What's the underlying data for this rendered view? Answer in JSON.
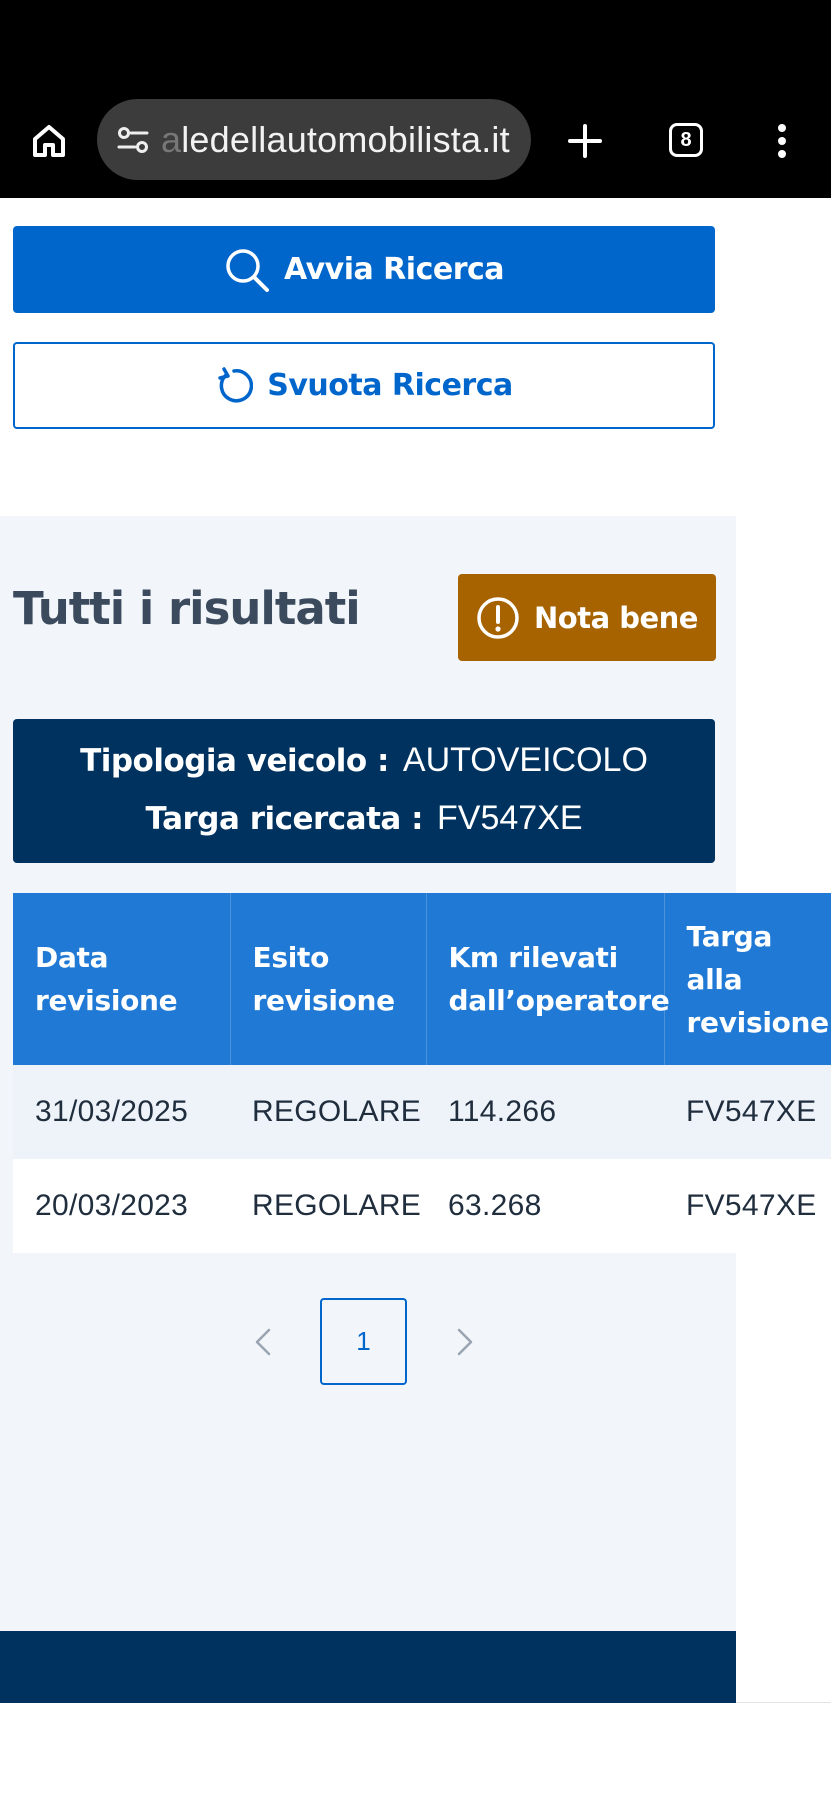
{
  "browser": {
    "url_faded": "a",
    "url": "ledellautomobilista.it",
    "tab_count": "8"
  },
  "buttons": {
    "search_label": "Avvia Ricerca",
    "reset_label": "Svuota Ricerca",
    "note_label": "Nota bene"
  },
  "results": {
    "title": "Tutti i risultati",
    "vehicle_type_label": "Tipologia veicolo :",
    "vehicle_type_value": "AUTOVEICOLO",
    "plate_label": "Targa ricercata :",
    "plate_value": "FV547XE"
  },
  "table": {
    "headers": {
      "c0": "Data revisione",
      "c1": "Esito revisione",
      "c2": "Km rilevati dall’operatore",
      "c3": "Targa alla revisione"
    },
    "rows": [
      {
        "date": "31/03/2025",
        "outcome": "REGOLARE",
        "km": "114.266",
        "plate": "FV547XE"
      },
      {
        "date": "20/03/2023",
        "outcome": "REGOLARE",
        "km": "63.268",
        "plate": "FV547XE"
      }
    ]
  },
  "pagination": {
    "current_page": "1"
  },
  "colors": {
    "primary": "#0066cc",
    "dark_navy": "#00325f",
    "table_header": "#2079d4",
    "warning": "#a66300",
    "section_bg": "#f2f6fb"
  },
  "icons": [
    "home-icon",
    "site-settings-icon",
    "plus-icon",
    "tabs-icon",
    "more-vert-icon",
    "search-icon",
    "refresh-icon",
    "exclamation-circle-icon",
    "chevron-left-icon",
    "chevron-right-icon"
  ]
}
